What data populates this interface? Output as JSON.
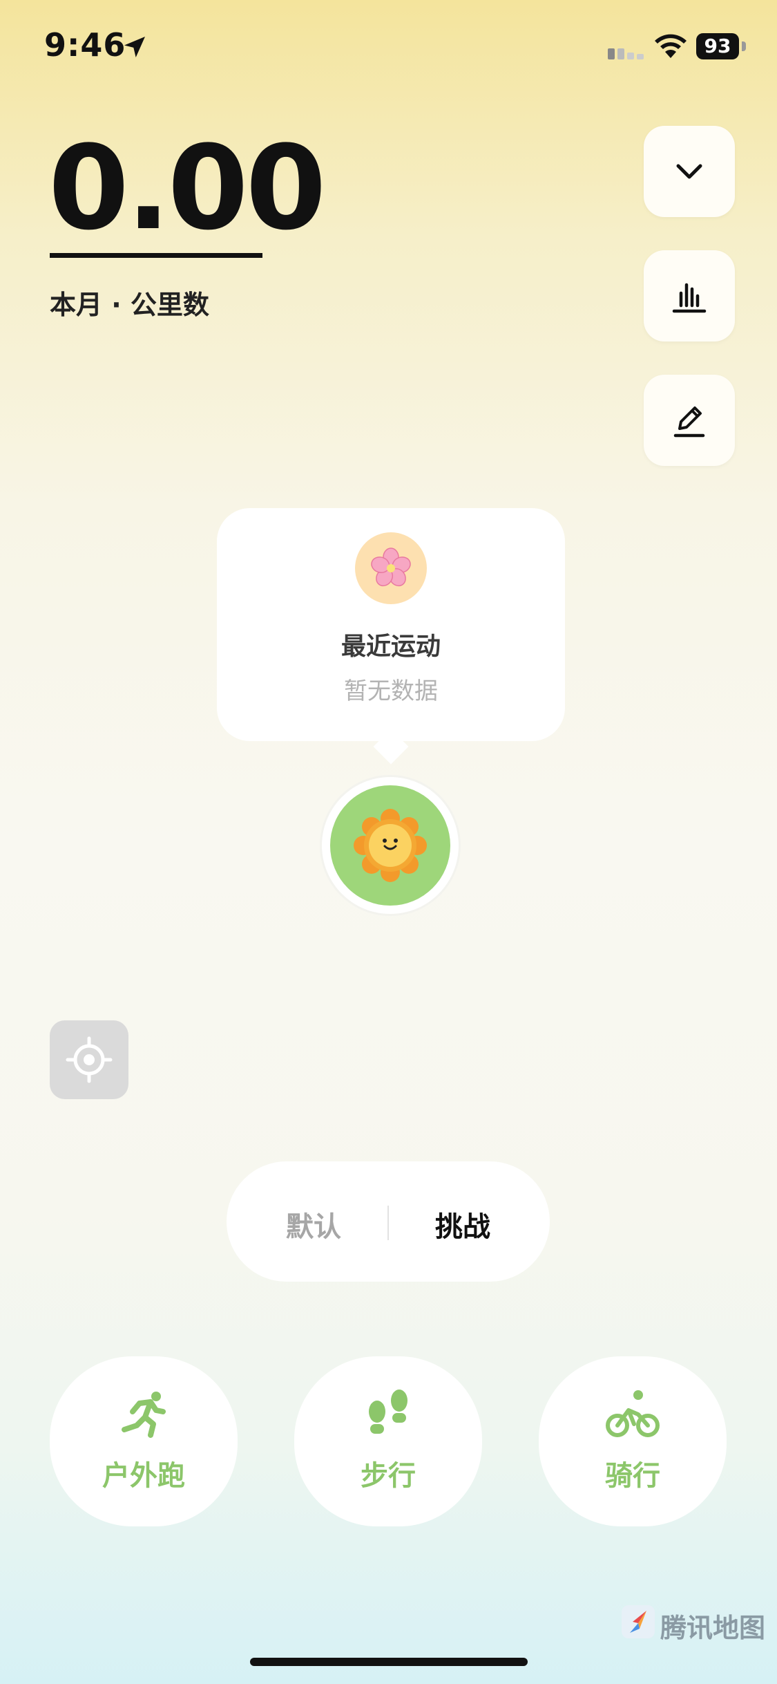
{
  "status_bar": {
    "time": "9:46",
    "battery": "93"
  },
  "summary": {
    "distance": "0.00",
    "label": "本月 · 公里数"
  },
  "side_buttons": [
    "chevron-down-icon",
    "bar-chart-icon",
    "edit-icon"
  ],
  "recent": {
    "title": "最近运动",
    "subtitle": "暂无数据"
  },
  "segment": {
    "default_label": "默认",
    "challenge_label": "挑战",
    "selected": "挑战"
  },
  "activities": [
    {
      "label": "户外跑",
      "icon": "running-icon"
    },
    {
      "label": "步行",
      "icon": "footprints-icon"
    },
    {
      "label": "骑行",
      "icon": "bicycle-icon"
    }
  ],
  "watermark": {
    "text": "腾讯地图"
  },
  "colors": {
    "accent_green": "#8cc66a",
    "avatar_bg": "#9ed67a",
    "sun_orange": "#f5a623"
  }
}
